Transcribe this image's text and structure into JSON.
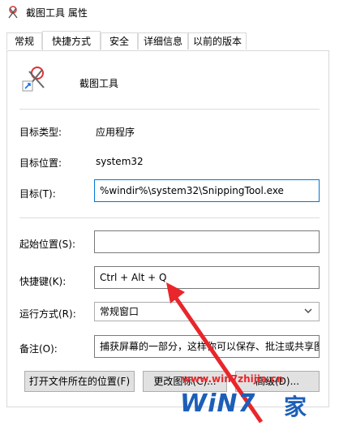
{
  "window": {
    "title": "截图工具 属性"
  },
  "tabs": [
    {
      "label": "常规",
      "active": false
    },
    {
      "label": "快捷方式",
      "active": true
    },
    {
      "label": "安全",
      "active": false
    },
    {
      "label": "详细信息",
      "active": false
    },
    {
      "label": "以前的版本",
      "active": false
    }
  ],
  "app": {
    "name": "截图工具"
  },
  "fields": {
    "target_type_label": "目标类型:",
    "target_type_value": "应用程序",
    "target_location_label": "目标位置:",
    "target_location_value": "system32",
    "target_label": "目标(T):",
    "target_value": "%windir%\\system32\\SnippingTool.exe",
    "start_in_label": "起始位置(S):",
    "start_in_value": "",
    "shortcut_key_label": "快捷键(K):",
    "shortcut_key_value": "Ctrl + Alt + Q",
    "run_label": "运行方式(R):",
    "run_value": "常规窗口",
    "comment_label": "备注(O):",
    "comment_value": "捕获屏幕的一部分，这样你可以保存、批注或共享图"
  },
  "buttons": {
    "open_location": "打开文件所在的位置(F)",
    "change_icon": "更改图标(C)...",
    "advanced": "高级(D)..."
  },
  "watermark": {
    "url": "www.win7zhijia.cn",
    "logo": "WiN7",
    "suffix": "家"
  },
  "colors": {
    "accent": "#0078d7",
    "annotation_arrow": "#e8262b",
    "watermark_blue": "#1c5fb8"
  }
}
